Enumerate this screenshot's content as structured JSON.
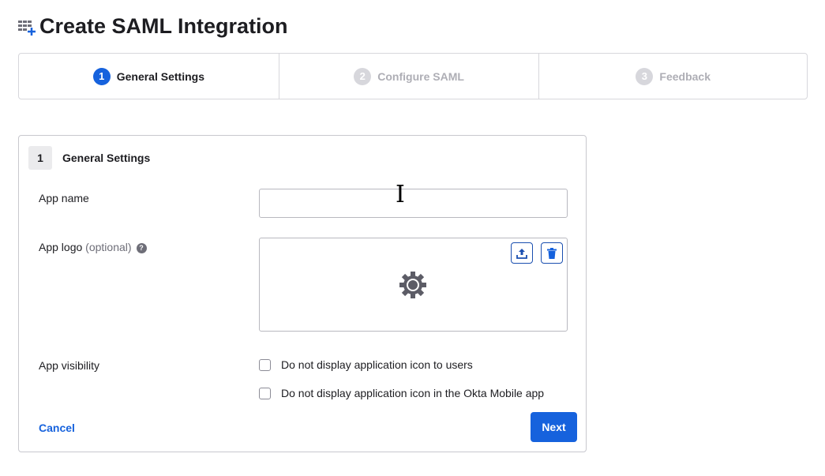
{
  "page": {
    "title": "Create SAML Integration"
  },
  "steps": [
    {
      "num": "1",
      "label": "General Settings"
    },
    {
      "num": "2",
      "label": "Configure SAML"
    },
    {
      "num": "3",
      "label": "Feedback"
    }
  ],
  "form": {
    "section_num": "1",
    "section_title": "General Settings",
    "app_name_label": "App name",
    "app_name_value": "",
    "app_logo_label": "App logo",
    "app_logo_optional": "(optional)",
    "help": "?",
    "app_visibility_label": "App visibility",
    "checkbox_1": "Do not display application icon to users",
    "checkbox_2": "Do not display application icon in the Okta Mobile app",
    "cancel": "Cancel",
    "next": "Next"
  },
  "colors": {
    "accent": "#1662dd"
  }
}
